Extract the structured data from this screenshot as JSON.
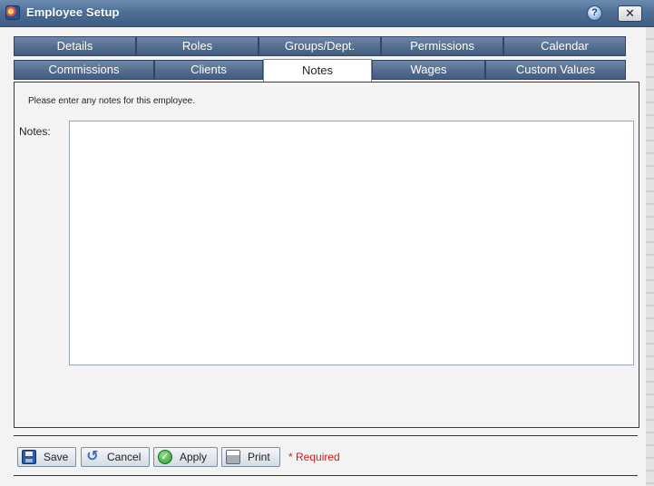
{
  "window": {
    "title": "Employee Setup",
    "help_label": "?",
    "close_label": "✕"
  },
  "tabs": {
    "row1": [
      "Details",
      "Roles",
      "Groups/Dept.",
      "Permissions",
      "Calendar"
    ],
    "row2": [
      "Commissions",
      "Clients",
      "Notes",
      "Wages",
      "Custom Values"
    ],
    "active": "Notes"
  },
  "notes": {
    "instructions": "Please enter any notes for this employee.",
    "label": "Notes:",
    "value": ""
  },
  "footer": {
    "save_label": "Save",
    "cancel_label": "Cancel",
    "apply_label": "Apply",
    "print_label": "Print",
    "required_label": "* Required"
  },
  "icons": {
    "app": "app-logo-icon",
    "help": "help-icon",
    "close": "close-icon",
    "save": "floppy-disk-icon",
    "cancel": "undo-arrow-icon",
    "apply": "check-circle-icon",
    "print": "printer-icon"
  },
  "colors": {
    "titlebar": "#4f6f96",
    "tab": "#536d90",
    "required": "#d41a1a"
  }
}
